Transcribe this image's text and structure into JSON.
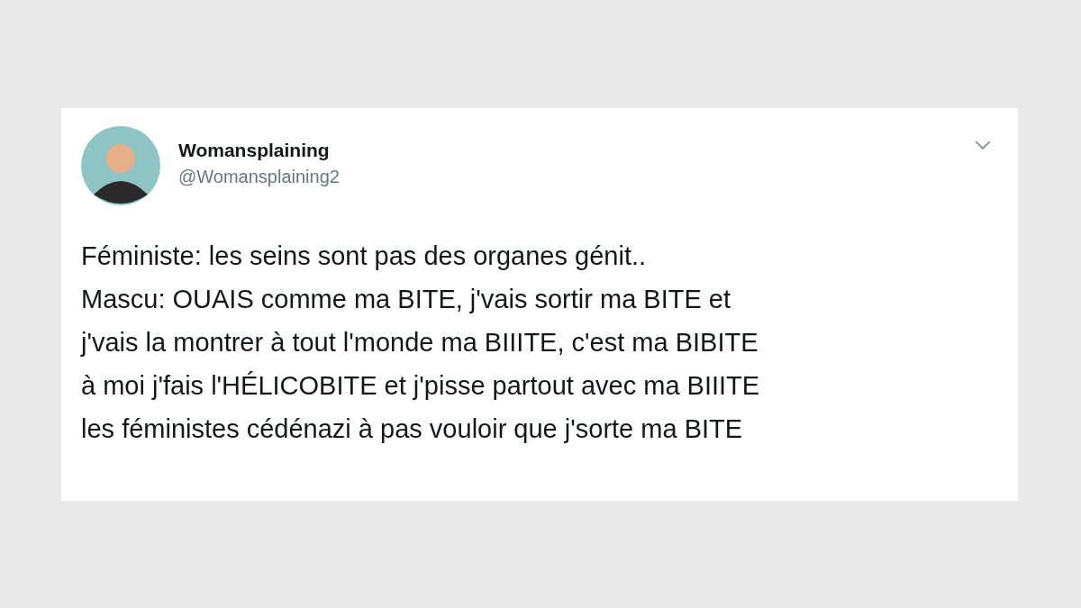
{
  "tweet": {
    "display_name": "Womansplaining",
    "handle": "@Womansplaining2",
    "lines": [
      "Féministe: les seins sont pas des organes génit..",
      "Mascu: OUAIS comme ma BITE, j'vais sortir ma BITE et",
      "j'vais la montrer à tout l'monde ma BIIITE, c'est ma BIBITE",
      "à moi j'fais l'HÉLICOBITE et j'pisse partout avec ma BIIITE",
      "les féministes cédénazi à pas vouloir que j'sorte ma BITE"
    ]
  }
}
